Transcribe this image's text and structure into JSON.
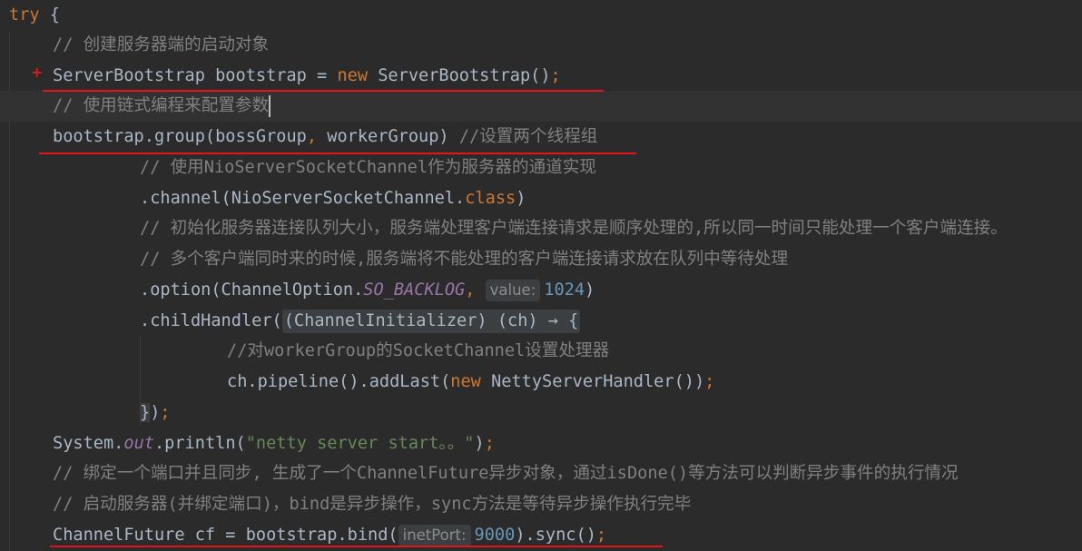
{
  "editor": {
    "lines": [
      {
        "id": "l1",
        "parts": [
          {
            "t": "try",
            "c": "kw"
          },
          {
            "t": " {",
            "c": ""
          }
        ]
      },
      {
        "id": "l2",
        "parts": [
          {
            "t": "// 创建服务器端的启动对象",
            "c": "cmt"
          }
        ]
      },
      {
        "id": "l3",
        "parts": [
          {
            "t": "ServerBootstrap bootstrap = ",
            "c": ""
          },
          {
            "t": "new",
            "c": "kw"
          },
          {
            "t": " ServerBootstrap()",
            "c": ""
          },
          {
            "t": ";",
            "c": "kw"
          }
        ]
      },
      {
        "id": "l4",
        "parts": [
          {
            "t": "// 使用链式编程来配置参数",
            "c": "cmt"
          }
        ]
      },
      {
        "id": "l5",
        "parts": [
          {
            "t": "bootstrap.group(bossGroup",
            "c": ""
          },
          {
            "t": ",",
            "c": "kw"
          },
          {
            "t": " workerGroup) ",
            "c": ""
          },
          {
            "t": "//设置两个线程组",
            "c": "cmt"
          }
        ]
      },
      {
        "id": "l6",
        "parts": [
          {
            "t": "// 使用NioServerSocketChannel作为服务器的通道实现",
            "c": "cmt"
          }
        ]
      },
      {
        "id": "l7",
        "parts": [
          {
            "t": ".channel(NioServerSocketChannel.",
            "c": ""
          },
          {
            "t": "class",
            "c": "kw"
          },
          {
            "t": ")",
            "c": ""
          }
        ]
      },
      {
        "id": "l8",
        "parts": [
          {
            "t": "// 初始化服务器连接队列大小，服务端处理客户端连接请求是顺序处理的,所以同一时间只能处理一个客户端连接。",
            "c": "cmt"
          }
        ]
      },
      {
        "id": "l9",
        "parts": [
          {
            "t": "// 多个客户端同时来的时候,服务端将不能处理的客户端连接请求放在队列中等待处理",
            "c": "cmt"
          }
        ]
      },
      {
        "id": "l10",
        "parts": [
          {
            "t": ".option(ChannelOption.",
            "c": ""
          },
          {
            "t": "SO_BACKLOG",
            "c": "static"
          },
          {
            "t": ", ",
            "c": "kw"
          },
          {
            "t": "value:",
            "c": "hint"
          },
          {
            "t": "1024",
            "c": "num"
          },
          {
            "t": ")",
            "c": ""
          }
        ]
      },
      {
        "id": "l11",
        "parts": [
          {
            "t": ".childHandler(",
            "c": ""
          },
          {
            "t": "(ChannelInitializer) (ch) → {",
            "c": "fold"
          }
        ]
      },
      {
        "id": "l12",
        "parts": [
          {
            "t": "//对workerGroup的SocketChannel设置处理器",
            "c": "cmt"
          }
        ]
      },
      {
        "id": "l13",
        "parts": [
          {
            "t": "ch.pipeline().addLast(",
            "c": ""
          },
          {
            "t": "new",
            "c": "kw"
          },
          {
            "t": " NettyServerHandler())",
            "c": ""
          },
          {
            "t": ";",
            "c": "kw"
          }
        ]
      },
      {
        "id": "l14",
        "parts": [
          {
            "t": "}",
            "c": "brace"
          },
          {
            "t": ")",
            "c": ""
          },
          {
            "t": ";",
            "c": "kw"
          }
        ]
      },
      {
        "id": "l15",
        "parts": [
          {
            "t": "System.",
            "c": ""
          },
          {
            "t": "out",
            "c": "field"
          },
          {
            "t": ".println(",
            "c": ""
          },
          {
            "t": "\"netty server start。。\"",
            "c": "str"
          },
          {
            "t": ")",
            "c": ""
          },
          {
            "t": ";",
            "c": "kw"
          }
        ]
      },
      {
        "id": "l16",
        "parts": [
          {
            "t": "// 绑定一个端口并且同步, 生成了一个ChannelFuture异步对象，通过isDone()等方法可以判断异步事件的执行情况",
            "c": "cmt"
          }
        ]
      },
      {
        "id": "l17",
        "parts": [
          {
            "t": "// 启动服务器(并绑定端口)，bind是异步操作，sync方法是等待异步操作执行完毕",
            "c": "cmt"
          }
        ]
      },
      {
        "id": "l18",
        "parts": [
          {
            "t": "ChannelFuture cf = bootstrap.bind(",
            "c": ""
          },
          {
            "t": "inetPort:",
            "c": "hint"
          },
          {
            "t": "9000",
            "c": "num"
          },
          {
            "t": ").sync()",
            "c": ""
          },
          {
            "t": ";",
            "c": "kw"
          }
        ]
      }
    ],
    "gutter_marker": "+",
    "colors": {
      "background": "#2b2b2b",
      "keyword": "#cc7832",
      "comment": "#808080",
      "string": "#6a8759",
      "number": "#6897bb",
      "static_field": "#9876aa",
      "underline": "#e0161b"
    }
  }
}
